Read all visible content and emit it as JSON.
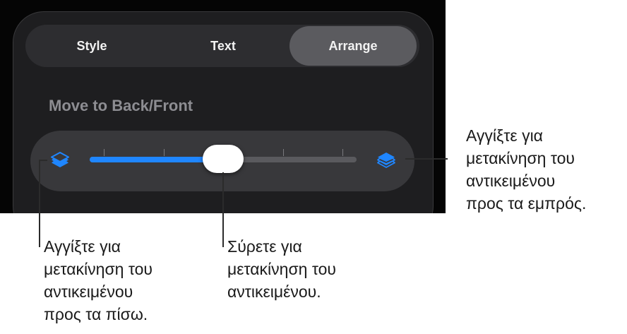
{
  "tabs": [
    {
      "label": "Style",
      "selected": false
    },
    {
      "label": "Text",
      "selected": false
    },
    {
      "label": "Arrange",
      "selected": true
    }
  ],
  "section": {
    "title": "Move to Back/Front"
  },
  "slider": {
    "value": 0.5,
    "tick_count": 5,
    "back_icon": "layers-back-icon",
    "front_icon": "layers-front-icon",
    "accent_color": "#1f86ff"
  },
  "callouts": {
    "front": "Αγγίξτε για\nμετακίνηση του\nαντικειμένου\nπρος τα εμπρός.",
    "back": "Αγγίξτε για\nμετακίνηση του\nαντικειμένου\nπρος τα πίσω.",
    "drag": "Σύρετε για\nμετακίνηση του\nαντικειμένου."
  }
}
